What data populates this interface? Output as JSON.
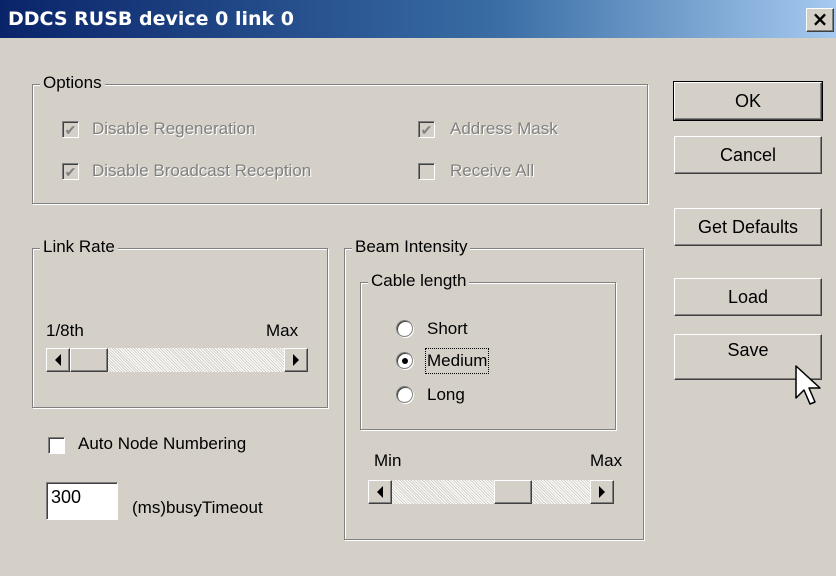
{
  "window": {
    "title": "DDCS RUSB device 0 link 0",
    "close_label": "×"
  },
  "options": {
    "legend": "Options",
    "disable_regeneration": {
      "label": "Disable Regeneration",
      "checked": true,
      "enabled": false
    },
    "disable_broadcast": {
      "label": "Disable Broadcast Reception",
      "checked": true,
      "enabled": false
    },
    "address_mask": {
      "label": "Address Mask",
      "checked": true,
      "enabled": false
    },
    "receive_all": {
      "label": "Receive All",
      "checked": false,
      "enabled": false
    }
  },
  "link_rate": {
    "legend": "Link Rate",
    "min_label": "1/8th",
    "max_label": "Max",
    "position": 0.0
  },
  "auto_node": {
    "label": "Auto Node Numbering",
    "checked": false
  },
  "busy_timeout": {
    "value": "300",
    "label": "(ms)busyTimeout"
  },
  "beam": {
    "legend": "Beam Intensity",
    "cable_legend": "Cable length",
    "options": [
      "Short",
      "Medium",
      "Long"
    ],
    "selected": "Medium",
    "min_label": "Min",
    "max_label": "Max",
    "position": 0.75
  },
  "buttons": {
    "ok": "OK",
    "cancel": "Cancel",
    "get_defaults": "Get Defaults",
    "load": "Load",
    "save": "Save"
  }
}
